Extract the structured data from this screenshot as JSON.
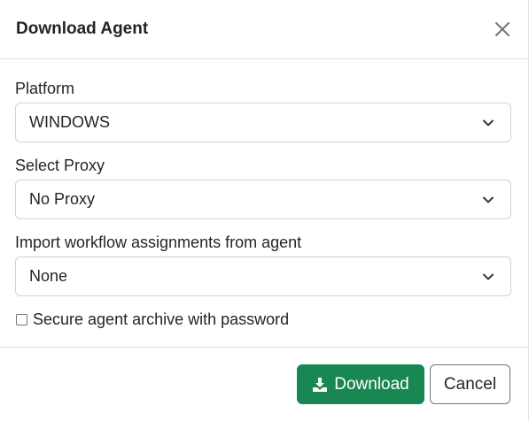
{
  "modal": {
    "title": "Download Agent",
    "close_icon": "close-icon"
  },
  "fields": {
    "platform": {
      "label": "Platform",
      "value": "WINDOWS"
    },
    "proxy": {
      "label": "Select Proxy",
      "value": "No Proxy"
    },
    "workflow": {
      "label": "Import workflow assignments from agent",
      "value": "None"
    }
  },
  "secure_archive": {
    "label": "Secure agent archive with password",
    "checked": false
  },
  "footer": {
    "download_label": "Download",
    "download_icon": "download-icon",
    "cancel_label": "Cancel"
  },
  "colors": {
    "primary_green": "#198754",
    "border": "#ced4da",
    "text": "#212529"
  }
}
